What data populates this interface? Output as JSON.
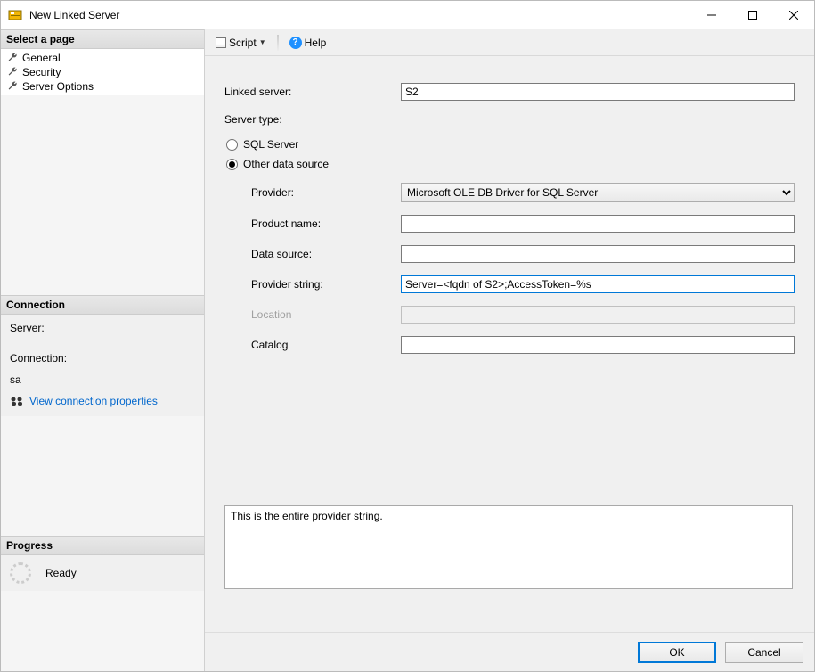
{
  "window": {
    "title": "New Linked Server"
  },
  "sidebar": {
    "select_page_header": "Select a page",
    "pages": [
      {
        "label": "General"
      },
      {
        "label": "Security"
      },
      {
        "label": "Server Options"
      }
    ],
    "connection_header": "Connection",
    "connection": {
      "server_label": "Server:",
      "server_value": "",
      "connection_label": "Connection:",
      "connection_value": "sa",
      "view_props_link": "View connection properties"
    },
    "progress_header": "Progress",
    "progress_status": "Ready"
  },
  "toolbar": {
    "script_label": "Script",
    "help_label": "Help"
  },
  "form": {
    "linked_server_label": "Linked server:",
    "linked_server_value": "S2",
    "server_type_label": "Server type:",
    "radio_sql": "SQL Server",
    "radio_other": "Other data source",
    "radio_selected": "other",
    "provider_label": "Provider:",
    "provider_value": "Microsoft OLE DB Driver for SQL Server",
    "product_name_label": "Product name:",
    "product_name_value": "",
    "data_source_label": "Data source:",
    "data_source_value": "",
    "provider_string_label": "Provider string:",
    "provider_string_value": "Server=<fqdn of S2>;AccessToken=%s",
    "location_label": "Location",
    "location_value": "",
    "catalog_label": "Catalog",
    "catalog_value": "",
    "description": "This is the entire provider string."
  },
  "buttons": {
    "ok": "OK",
    "cancel": "Cancel"
  }
}
